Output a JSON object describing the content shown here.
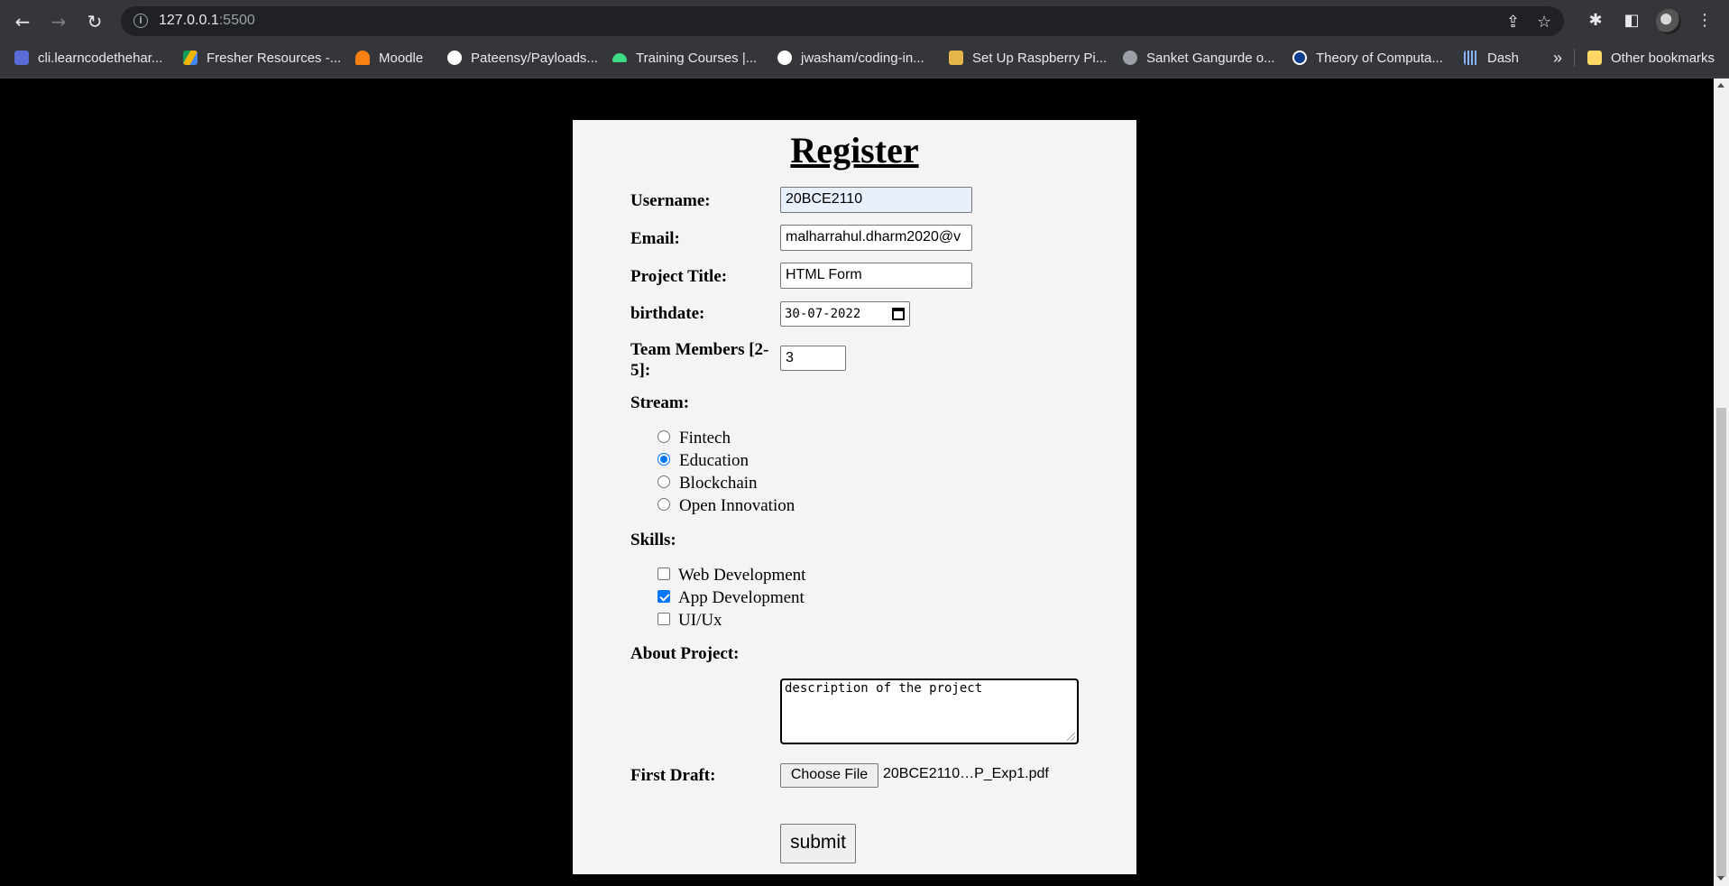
{
  "browser": {
    "url_host": "127.0.0.1",
    "url_port": ":5500",
    "bookmarks": [
      {
        "label": "cli.learncodethehar...",
        "color": "#5d6bd6"
      },
      {
        "label": "Fresher Resources -...",
        "color": "#f4b400"
      },
      {
        "label": "Moodle",
        "color": "#f98012"
      },
      {
        "label": "Pateensy/Payloads...",
        "color": "#ffffff"
      },
      {
        "label": "Training Courses |...",
        "color": "#3ddc84"
      },
      {
        "label": "jwasham/coding-in...",
        "color": "#ffffff"
      },
      {
        "label": "Set Up Raspberry Pi...",
        "color": "#e8b54a"
      },
      {
        "label": "Sanket Gangurde o...",
        "color": "#9aa0a6"
      },
      {
        "label": "Theory of Computa...",
        "color": "#0b3d91"
      },
      {
        "label": "Dash",
        "color": "#8ab4f8"
      }
    ],
    "overflow_label": "»",
    "other_bookmarks": "Other bookmarks"
  },
  "form": {
    "title": "Register",
    "username_label": "Username:",
    "username_value": "20BCE2110",
    "email_label": "Email:",
    "email_value": "malharrahul.dharm2020@v",
    "project_title_label": "Project Title:",
    "project_title_value": "HTML Form",
    "birthdate_label": "birthdate:",
    "birthdate_value": "30-07-2022",
    "team_members_label_1": "Team Members [2-",
    "team_members_label_2": "5]:",
    "team_members_value": "3",
    "stream_label": "Stream:",
    "stream_options": [
      {
        "label": "Fintech",
        "checked": false
      },
      {
        "label": "Education",
        "checked": true
      },
      {
        "label": "Blockchain",
        "checked": false
      },
      {
        "label": "Open Innovation",
        "checked": false
      }
    ],
    "skills_label": "Skills:",
    "skills_options": [
      {
        "label": "Web Development",
        "checked": false
      },
      {
        "label": "App Development",
        "checked": true
      },
      {
        "label": "UI/Ux",
        "checked": false
      }
    ],
    "about_label": "About Project:",
    "about_value": "description of the project",
    "draft_label": "First Draft:",
    "choose_file_label": "Choose File",
    "file_name": "20BCE2110…P_Exp1.pdf",
    "submit_label": "submit"
  },
  "colors": {
    "accent": "#0075ff",
    "autofill": "#e8f0fe",
    "panel": "#f4f4f4",
    "page_bg": "#000000"
  }
}
